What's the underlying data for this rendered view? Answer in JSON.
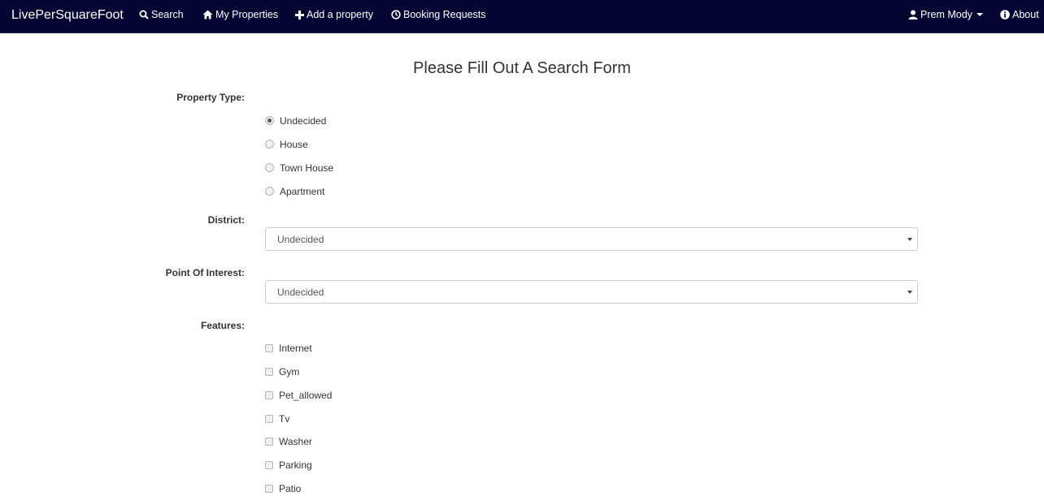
{
  "navbar": {
    "brand": "LivePerSquareFoot",
    "items": [
      {
        "label": "Search",
        "icon": "search-icon"
      },
      {
        "label": "My Properties",
        "icon": "home-icon"
      },
      {
        "label": "Add a property",
        "icon": "plus-icon"
      },
      {
        "label": "Booking Requests",
        "icon": "clock-icon"
      }
    ],
    "user": {
      "label": "Prem Mody",
      "icon": "user-icon"
    },
    "about": {
      "label": "About",
      "icon": "info-icon"
    }
  },
  "form": {
    "title": "Please Fill Out A Search Form",
    "property_type": {
      "label": "Property Type:",
      "options": [
        "Undecided",
        "House",
        "Town House",
        "Apartment"
      ],
      "selected": "Undecided"
    },
    "district": {
      "label": "District:",
      "value": "Undecided"
    },
    "point_of_interest": {
      "label": "Point Of Interest:",
      "value": "Undecided"
    },
    "features": {
      "label": "Features:",
      "options": [
        "Internet",
        "Gym",
        "Pet_allowed",
        "Tv",
        "Washer",
        "Parking",
        "Patio"
      ]
    }
  },
  "colors": {
    "navbar_bg": "#050533",
    "text": "#333333"
  }
}
